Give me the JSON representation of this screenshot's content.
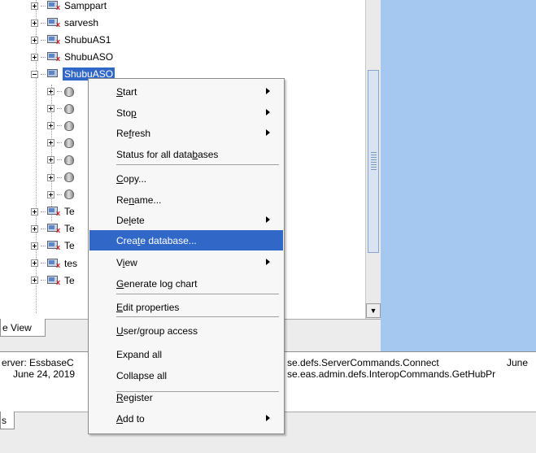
{
  "tree": {
    "servers_top": [
      {
        "label": "Samppart",
        "icon": "server-error-icon"
      },
      {
        "label": "sarvesh",
        "icon": "server-error-icon"
      },
      {
        "label": "ShubuAS1",
        "icon": "server-error-icon"
      },
      {
        "label": "ShubuASO",
        "icon": "server-error-icon"
      }
    ],
    "selected": {
      "label": "ShubuASO",
      "icon": "server-icon"
    },
    "databases_count": 7,
    "servers_bottom": [
      {
        "label": "Te"
      },
      {
        "label": "Te"
      },
      {
        "label": "Te"
      },
      {
        "label": "tes"
      },
      {
        "label": "Te"
      }
    ]
  },
  "tab": {
    "label": "e View"
  },
  "log": {
    "left_line1": "erver: EssbaseC",
    "left_line2": "June 24, 2019",
    "mid_line1": "se.defs.ServerCommands.Connect",
    "mid_line2": "se.eas.admin.defs.InteropCommands.GetHubPr",
    "right_line1": "June"
  },
  "bottom_tab": {
    "label": "s"
  },
  "menu": {
    "items": [
      {
        "key": "start",
        "pre": "",
        "u": "S",
        "post": "tart",
        "submenu": true
      },
      {
        "key": "stop",
        "pre": "Sto",
        "u": "p",
        "post": "",
        "submenu": true
      },
      {
        "key": "refresh",
        "pre": "Re",
        "u": "f",
        "post": "resh",
        "submenu": true
      },
      {
        "key": "status",
        "pre": "Status for all data",
        "u": "b",
        "post": "ases",
        "submenu": false
      },
      {
        "key": "copy",
        "pre": "",
        "u": "C",
        "post": "opy...",
        "submenu": false
      },
      {
        "key": "rename",
        "pre": "Re",
        "u": "n",
        "post": "ame...",
        "submenu": false
      },
      {
        "key": "delete",
        "pre": "De",
        "u": "l",
        "post": "ete",
        "submenu": true
      },
      {
        "key": "create-database",
        "pre": "Crea",
        "u": "t",
        "post": "e database...",
        "submenu": false
      },
      {
        "key": "view",
        "pre": "V",
        "u": "i",
        "post": "ew",
        "submenu": true
      },
      {
        "key": "generate-log-chart",
        "pre": "",
        "u": "G",
        "post": "enerate log chart",
        "submenu": false
      },
      {
        "key": "edit-properties",
        "pre": "",
        "u": "E",
        "post": "dit properties",
        "submenu": false
      },
      {
        "key": "user-group-access",
        "pre": "",
        "u": "U",
        "post": "ser/group access",
        "submenu": false
      },
      {
        "key": "expand-all",
        "pre": "Expand all",
        "u": "",
        "post": "",
        "submenu": false
      },
      {
        "key": "collapse-all",
        "pre": "Collapse all",
        "u": "",
        "post": "",
        "submenu": false
      },
      {
        "key": "register",
        "pre": "",
        "u": "R",
        "post": "egister",
        "submenu": false
      },
      {
        "key": "add-to",
        "pre": "",
        "u": "A",
        "post": "dd to",
        "submenu": true
      }
    ],
    "highlighted": "create-database"
  },
  "colors": {
    "selection": "#3168c8",
    "right_panel": "#a4c8f0"
  }
}
